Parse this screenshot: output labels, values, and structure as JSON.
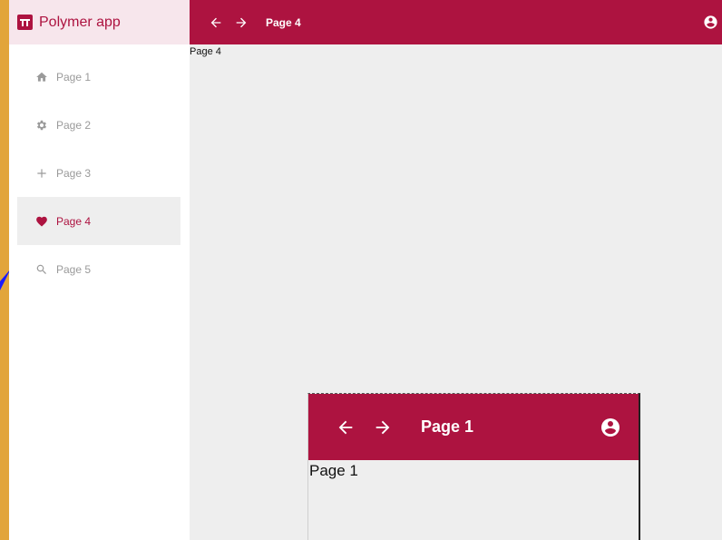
{
  "app": {
    "title": "Polymer app",
    "brand_color": "#ad1340",
    "logo_icon": "polymer-logo-icon"
  },
  "sidebar": {
    "items": [
      {
        "label": "Page 1",
        "icon": "home-icon",
        "active": false
      },
      {
        "label": "Page 2",
        "icon": "gear-icon",
        "active": false
      },
      {
        "label": "Page 3",
        "icon": "plus-icon",
        "active": false
      },
      {
        "label": "Page 4",
        "icon": "heart-icon",
        "active": true
      },
      {
        "label": "Page 5",
        "icon": "search-icon",
        "active": false
      }
    ]
  },
  "topbar": {
    "title": "Page 4",
    "back_icon": "arrow-left-icon",
    "forward_icon": "arrow-right-icon",
    "account_icon": "account-circle-icon"
  },
  "content": {
    "text": "Page 4"
  },
  "mini_window": {
    "title": "Page 1",
    "content": "Page 1"
  }
}
